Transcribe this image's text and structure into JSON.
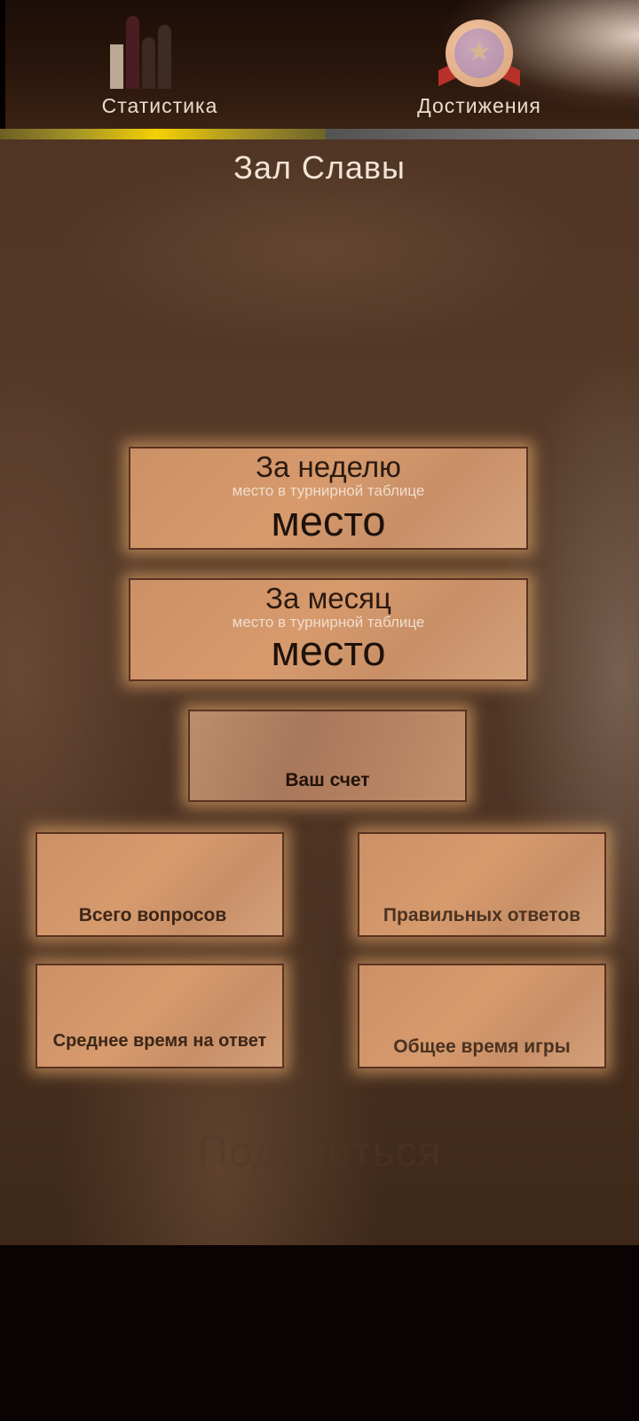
{
  "tabs": {
    "stats_label": "Статистика",
    "achievements_label": "Достижения"
  },
  "progress": {
    "fraction": 0.51,
    "color": "#f5d000"
  },
  "hall_of_fame": {
    "title": "Зал Славы",
    "week": {
      "title": "За неделю",
      "subtitle": "место в турнирной таблице",
      "value": "место"
    },
    "month": {
      "title": "За месяц",
      "subtitle": "место в турнирной таблице",
      "value": "место"
    },
    "score_label": "Ваш счет",
    "total_questions_label": "Всего вопросов",
    "correct_answers_label": "Правильных ответов",
    "avg_time_label": "Среднее время на ответ",
    "total_time_label": "Общее время игры",
    "share_label": "Поделиться"
  },
  "icons": {
    "stats": "bar-chart-icon",
    "achievements": "medal-icon"
  }
}
